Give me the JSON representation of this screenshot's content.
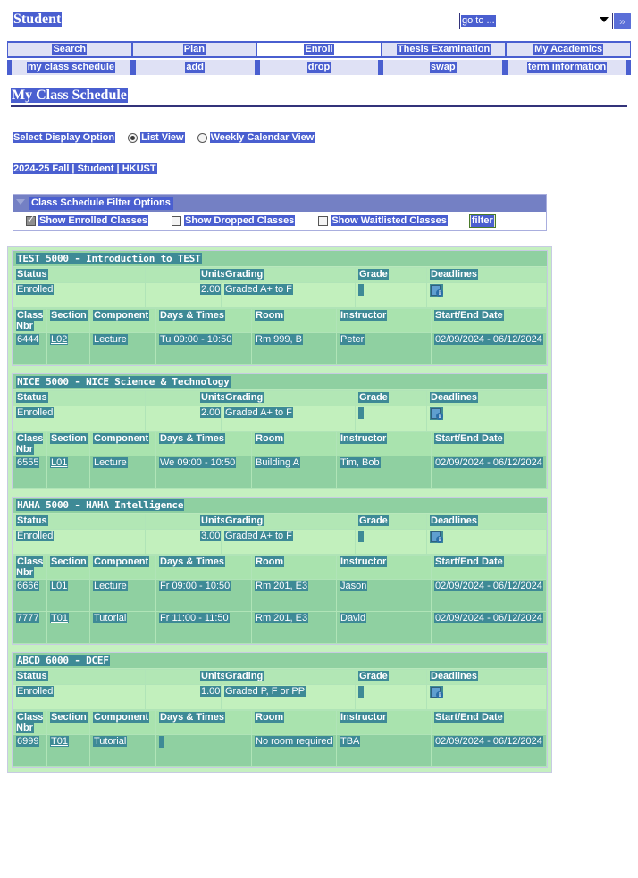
{
  "topbar": {
    "brand": "Student",
    "goto_placeholder": "go to ...",
    "goto_button_icon": "»"
  },
  "nav_primary": [
    {
      "label": "Search",
      "active": false
    },
    {
      "label": "Plan",
      "active": false
    },
    {
      "label": "Enroll",
      "active": true
    },
    {
      "label": "Thesis Examination",
      "active": false
    },
    {
      "label": "My Academics",
      "active": false
    }
  ],
  "nav_secondary": [
    {
      "label": "my class schedule"
    },
    {
      "label": "add"
    },
    {
      "label": "drop"
    },
    {
      "label": "swap"
    },
    {
      "label": "term information"
    }
  ],
  "page": {
    "title": "My Class Schedule",
    "display_option_label": "Select Display Option",
    "term_line": "2024-25 Fall | Student | HKUST"
  },
  "display_options": [
    {
      "label": "List View",
      "selected": true
    },
    {
      "label": "Weekly Calendar View",
      "selected": false
    }
  ],
  "filter_panel": {
    "heading": "Class Schedule Filter Options",
    "checkboxes": [
      {
        "label": "Show Enrolled Classes",
        "checked": true
      },
      {
        "label": "Show Dropped Classes",
        "checked": false
      },
      {
        "label": "Show Waitlisted Classes",
        "checked": false
      }
    ],
    "filter_button": "filter"
  },
  "table_headers": {
    "status": [
      "Status",
      "",
      "Units",
      "Grading",
      "Grade",
      "Deadlines"
    ],
    "meeting": [
      "Class Nbr",
      "Section",
      "Component",
      "Days & Times",
      "Room",
      "Instructor",
      "Start/End Date"
    ]
  },
  "courses": [
    {
      "title": "TEST 5000 - Introduction to TEST",
      "status": "Enrolled",
      "units": "2.00",
      "grading": "Graded A+ to F",
      "grade": "",
      "meetings": [
        {
          "class_nbr": "6444",
          "section": "L02",
          "component": "Lecture",
          "days_times": "Tu 09:00 - 10:50",
          "room": "Rm 999, B",
          "instructor": "Peter",
          "start_end": "02/09/2024 - 06/12/2024"
        }
      ]
    },
    {
      "title": "NICE 5000 - NICE Science & Technology",
      "status": "Enrolled",
      "units": "2.00",
      "grading": "Graded A+ to F",
      "grade": "",
      "meetings": [
        {
          "class_nbr": "6555",
          "section": "L01",
          "component": "Lecture",
          "days_times": "We 09:00 - 10:50",
          "room": "Building A",
          "instructor": "Tim, Bob",
          "start_end": "02/09/2024 - 06/12/2024"
        }
      ]
    },
    {
      "title": "HAHA 5000 - HAHA Intelligence",
      "status": "Enrolled",
      "units": "3.00",
      "grading": "Graded A+ to F",
      "grade": "",
      "meetings": [
        {
          "class_nbr": "6666",
          "section": "L01",
          "component": "Lecture",
          "days_times": "Fr 09:00 - 10:50",
          "room": "Rm 201, E3",
          "instructor": "Jason",
          "start_end": "02/09/2024 - 06/12/2024"
        },
        {
          "class_nbr": "7777",
          "section": "T01",
          "component": "Tutorial",
          "days_times": "Fr 11:00 - 11:50",
          "room": "Rm 201, E3",
          "instructor": "David",
          "start_end": "02/09/2024 - 06/12/2024"
        }
      ]
    },
    {
      "title": "ABCD 6000 - DCEF",
      "status": "Enrolled",
      "units": "1.00",
      "grading": "Graded P, F or PP",
      "grade": "",
      "meetings": [
        {
          "class_nbr": "6999",
          "section": "T01",
          "component": "Tutorial",
          "days_times": "",
          "room": "No room required",
          "instructor": "TBA",
          "start_end": "02/09/2024 - 06/12/2024"
        }
      ]
    }
  ],
  "colors": {
    "accent_blue": "#4a5fd0",
    "nav_bar": "#4a5fd0",
    "tab_bg": "#dfe1f5",
    "panel_head": "#7480c4",
    "course_header_green": "#8fd0a1",
    "grid_header_green": "#a9e3ae",
    "row_green": "#c2f0bd",
    "selection_teal": "#3e8a96",
    "filter_button_bg": "#e7edc8"
  }
}
